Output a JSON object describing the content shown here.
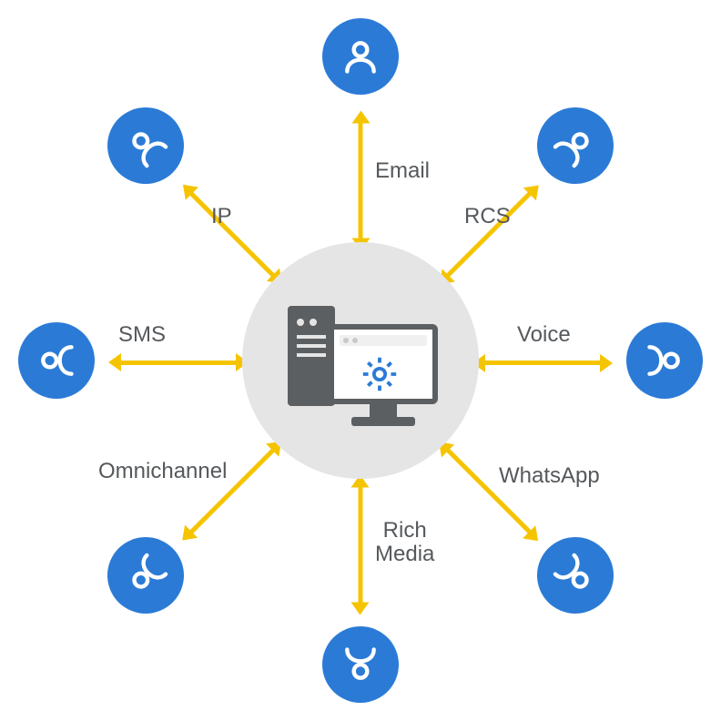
{
  "center": {
    "kind": "server-and-workstation"
  },
  "channels": [
    {
      "key": "email",
      "label": "Email"
    },
    {
      "key": "rcs",
      "label": "RCS"
    },
    {
      "key": "voice",
      "label": "Voice"
    },
    {
      "key": "whatsapp",
      "label": "WhatsApp"
    },
    {
      "key": "rich_media",
      "label": "Rich\nMedia"
    },
    {
      "key": "omnichannel",
      "label": "Omnichannel"
    },
    {
      "key": "sms",
      "label": "SMS"
    },
    {
      "key": "ip",
      "label": "IP"
    }
  ],
  "colors": {
    "node": "#2b7bd6",
    "hub": "#e5e5e5",
    "arrow": "#f5c400",
    "text": "#55595c"
  }
}
